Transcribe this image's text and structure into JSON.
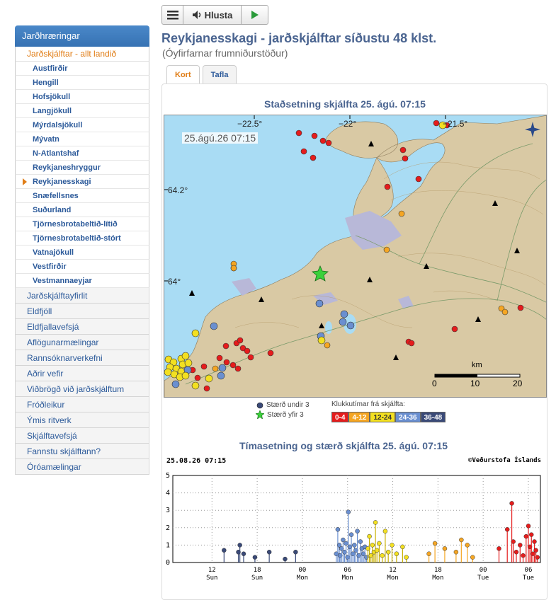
{
  "toolbar": {
    "listen_label": "Hlusta"
  },
  "sidebar": {
    "header": "Jarðhræringar",
    "current": "Jarðskjálftar - allt landið",
    "regions": [
      {
        "label": "Austfirðir",
        "active": false
      },
      {
        "label": "Hengill",
        "active": false
      },
      {
        "label": "Hofsjökull",
        "active": false
      },
      {
        "label": "Langjökull",
        "active": false
      },
      {
        "label": "Mýrdalsjökull",
        "active": false
      },
      {
        "label": "Mývatn",
        "active": false
      },
      {
        "label": "N-Atlantshaf",
        "active": false
      },
      {
        "label": "Reykjaneshryggur",
        "active": false
      },
      {
        "label": "Reykjanesskagi",
        "active": true
      },
      {
        "label": "Snæfellsnes",
        "active": false
      },
      {
        "label": "Suðurland",
        "active": false
      },
      {
        "label": "Tjörnesbrotabeltið-lítið",
        "active": false
      },
      {
        "label": "Tjörnesbrotabeltið-stórt",
        "active": false
      },
      {
        "label": "Vatnajökull",
        "active": false
      },
      {
        "label": "Vestfirðir",
        "active": false
      },
      {
        "label": "Vestmannaeyjar",
        "active": false
      }
    ],
    "sections": [
      "Jarðskjálftayfirlit",
      "Eldfjöll",
      "Eldfjallavefsjá",
      "Aflögunarmælingar",
      "Rannsóknarverkefni",
      "Aðrir vefir",
      "Viðbrögð við jarðskjálftum",
      "Fróðleikur",
      "Ýmis ritverk",
      "Skjálftavefsjá",
      "Fannstu skjálftann?",
      "Óróamælingar"
    ]
  },
  "main": {
    "title": "Reykjanesskagi - jarðskjálftar síðustu 48 klst.",
    "subtitle": "(Óyfirfarnar frumniðurstöður)",
    "tabs": [
      "Kort",
      "Tafla"
    ],
    "map_title": "Staðsetning skjálfta   25. ágú. 07:15",
    "map_timestamp": "25.ágú.26  07:15",
    "lon_labels": [
      "−22.5°",
      "−22°",
      "−21.5°"
    ],
    "lat_labels": [
      "64.2°",
      "64°"
    ],
    "scale": {
      "unit": "km",
      "ticks": [
        "0",
        "10",
        "20"
      ]
    },
    "legend": {
      "small": "Stærð undir 3",
      "large": "Stærð yfir 3",
      "hours_title": "Klukkutímar frá skjálfta:",
      "bins": [
        {
          "label": "0-4",
          "bg": "#e51c1c",
          "fg": "#ffffff"
        },
        {
          "label": "4-12",
          "bg": "#f5a623",
          "fg": "#ffffff"
        },
        {
          "label": "12-24",
          "bg": "#f3e021",
          "fg": "#333333"
        },
        {
          "label": "24-36",
          "bg": "#6a8fd0",
          "fg": "#ffffff"
        },
        {
          "label": "36-48",
          "bg": "#3a4a78",
          "fg": "#ffffff"
        }
      ]
    },
    "chart_title": "Tímasetning og stærð skjálfta   25. ágú. 07:15",
    "chart_timestamp": "25.08.26 07:15",
    "chart_copyright": "©Veðurstofa Íslands"
  },
  "chart_data": {
    "type": "scatter",
    "title": "Tímasetning og stærð skjálfta   25. ágú. 07:15",
    "ylim": [
      0,
      5
    ],
    "y_ticks": [
      "0",
      "1",
      "2",
      "3",
      "4",
      "5"
    ],
    "x_ticks": [
      {
        "hour": 12,
        "label": "12",
        "day": "Sun"
      },
      {
        "hour": 18,
        "label": "18",
        "day": "Sun"
      },
      {
        "hour": 24,
        "label": "00",
        "day": "Mon"
      },
      {
        "hour": 30,
        "label": "06",
        "day": "Mon"
      },
      {
        "hour": 36,
        "label": "12",
        "day": "Mon"
      },
      {
        "hour": 42,
        "label": "18",
        "day": "Mon"
      },
      {
        "hour": 48,
        "label": "00",
        "day": "Tue"
      },
      {
        "hour": 54,
        "label": "06",
        "day": "Tue"
      }
    ],
    "xlim": [
      6.8,
      55.6
    ],
    "series": [
      {
        "color": "#3a4a78",
        "points": [
          [
            13.6,
            0.7
          ],
          [
            15.5,
            0.6
          ],
          [
            15.7,
            1.0
          ],
          [
            16.2,
            0.5
          ],
          [
            17.7,
            0.3
          ],
          [
            19.6,
            0.6
          ],
          [
            21.7,
            0.2
          ],
          [
            23.1,
            0.6
          ]
        ]
      },
      {
        "color": "#6a8fd0",
        "points": [
          [
            28.5,
            0.5
          ],
          [
            28.7,
            1.9
          ],
          [
            28.9,
            1.0
          ],
          [
            29.0,
            0.4
          ],
          [
            29.2,
            0.8
          ],
          [
            29.4,
            1.3
          ],
          [
            29.6,
            0.6
          ],
          [
            29.8,
            1.1
          ],
          [
            30.0,
            0.3
          ],
          [
            30.1,
            2.9
          ],
          [
            30.3,
            0.9
          ],
          [
            30.5,
            1.6
          ],
          [
            30.7,
            0.5
          ],
          [
            30.9,
            1.0
          ],
          [
            31.1,
            0.7
          ],
          [
            31.3,
            1.8
          ],
          [
            31.5,
            0.4
          ],
          [
            31.7,
            1.2
          ],
          [
            31.9,
            0.8
          ],
          [
            32.1,
            0.5
          ],
          [
            32.3,
            0.9
          ],
          [
            32.5,
            0.3
          ]
        ]
      },
      {
        "color": "#f3e021",
        "points": [
          [
            32.7,
            0.8
          ],
          [
            32.9,
            1.5
          ],
          [
            33.1,
            0.4
          ],
          [
            33.3,
            1.0
          ],
          [
            33.5,
            0.6
          ],
          [
            33.7,
            2.3
          ],
          [
            33.9,
            0.7
          ],
          [
            34.2,
            1.1
          ],
          [
            34.6,
            0.4
          ],
          [
            35.0,
            1.8
          ],
          [
            35.4,
            0.6
          ],
          [
            35.9,
            1.0
          ],
          [
            36.5,
            0.5
          ],
          [
            37.3,
            0.9
          ],
          [
            37.8,
            0.3
          ]
        ]
      },
      {
        "color": "#f5a623",
        "points": [
          [
            40.8,
            0.5
          ],
          [
            41.6,
            1.1
          ],
          [
            42.9,
            0.8
          ],
          [
            44.4,
            0.6
          ],
          [
            45.1,
            1.3
          ],
          [
            45.9,
            1.0
          ],
          [
            46.6,
            0.3
          ]
        ]
      },
      {
        "color": "#e51c1c",
        "points": [
          [
            50.1,
            0.8
          ],
          [
            51.2,
            1.9
          ],
          [
            51.8,
            3.4
          ],
          [
            52.0,
            1.2
          ],
          [
            52.4,
            0.6
          ],
          [
            52.9,
            1.0
          ],
          [
            53.3,
            0.4
          ],
          [
            53.7,
            1.5
          ],
          [
            54.0,
            2.1
          ],
          [
            54.2,
            0.9
          ],
          [
            54.4,
            1.6
          ],
          [
            54.6,
            0.5
          ],
          [
            54.8,
            1.2
          ],
          [
            55.0,
            0.7
          ],
          [
            55.2,
            0.3
          ]
        ]
      }
    ]
  }
}
